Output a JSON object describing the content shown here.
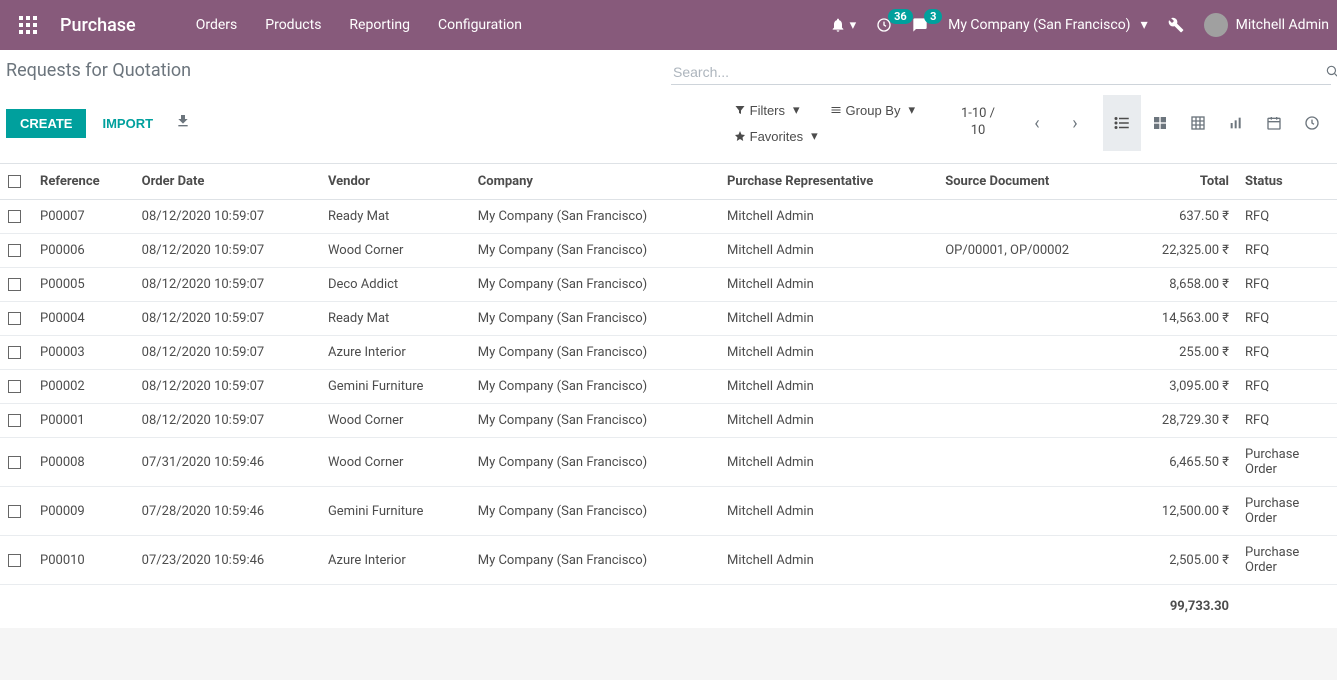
{
  "header": {
    "brand": "Purchase",
    "menu": [
      "Orders",
      "Products",
      "Reporting",
      "Configuration"
    ],
    "activity_badge": "36",
    "chat_badge": "3",
    "company": "My Company (San Francisco)",
    "user": "Mitchell Admin"
  },
  "breadcrumb": "Requests for Quotation",
  "search": {
    "placeholder": "Search..."
  },
  "buttons": {
    "create": "CREATE",
    "import": "IMPORT"
  },
  "filters": {
    "filters_label": "Filters",
    "groupby_label": "Group By",
    "favorites_label": "Favorites"
  },
  "pager": {
    "line1": "1-10 /",
    "line2": "10"
  },
  "columns": {
    "reference": "Reference",
    "order_date": "Order Date",
    "vendor": "Vendor",
    "company": "Company",
    "rep": "Purchase Representative",
    "source": "Source Document",
    "total": "Total",
    "status": "Status"
  },
  "rows": [
    {
      "ref": "P00007",
      "date": "08/12/2020 10:59:07",
      "vendor": "Ready Mat",
      "company": "My Company (San Francisco)",
      "rep": "Mitchell Admin",
      "src": "",
      "total": "637.50 ₹",
      "status": "RFQ"
    },
    {
      "ref": "P00006",
      "date": "08/12/2020 10:59:07",
      "vendor": "Wood Corner",
      "company": "My Company (San Francisco)",
      "rep": "Mitchell Admin",
      "src": "OP/00001, OP/00002",
      "total": "22,325.00 ₹",
      "status": "RFQ"
    },
    {
      "ref": "P00005",
      "date": "08/12/2020 10:59:07",
      "vendor": "Deco Addict",
      "company": "My Company (San Francisco)",
      "rep": "Mitchell Admin",
      "src": "",
      "total": "8,658.00 ₹",
      "status": "RFQ"
    },
    {
      "ref": "P00004",
      "date": "08/12/2020 10:59:07",
      "vendor": "Ready Mat",
      "company": "My Company (San Francisco)",
      "rep": "Mitchell Admin",
      "src": "",
      "total": "14,563.00 ₹",
      "status": "RFQ"
    },
    {
      "ref": "P00003",
      "date": "08/12/2020 10:59:07",
      "vendor": "Azure Interior",
      "company": "My Company (San Francisco)",
      "rep": "Mitchell Admin",
      "src": "",
      "total": "255.00 ₹",
      "status": "RFQ"
    },
    {
      "ref": "P00002",
      "date": "08/12/2020 10:59:07",
      "vendor": "Gemini Furniture",
      "company": "My Company (San Francisco)",
      "rep": "Mitchell Admin",
      "src": "",
      "total": "3,095.00 ₹",
      "status": "RFQ"
    },
    {
      "ref": "P00001",
      "date": "08/12/2020 10:59:07",
      "vendor": "Wood Corner",
      "company": "My Company (San Francisco)",
      "rep": "Mitchell Admin",
      "src": "",
      "total": "28,729.30 ₹",
      "status": "RFQ"
    },
    {
      "ref": "P00008",
      "date": "07/31/2020 10:59:46",
      "vendor": "Wood Corner",
      "company": "My Company (San Francisco)",
      "rep": "Mitchell Admin",
      "src": "",
      "total": "6,465.50 ₹",
      "status": "Purchase Order"
    },
    {
      "ref": "P00009",
      "date": "07/28/2020 10:59:46",
      "vendor": "Gemini Furniture",
      "company": "My Company (San Francisco)",
      "rep": "Mitchell Admin",
      "src": "",
      "total": "12,500.00 ₹",
      "status": "Purchase Order"
    },
    {
      "ref": "P00010",
      "date": "07/23/2020 10:59:46",
      "vendor": "Azure Interior",
      "company": "My Company (San Francisco)",
      "rep": "Mitchell Admin",
      "src": "",
      "total": "2,505.00 ₹",
      "status": "Purchase Order"
    }
  ],
  "footer_total": "99,733.30"
}
